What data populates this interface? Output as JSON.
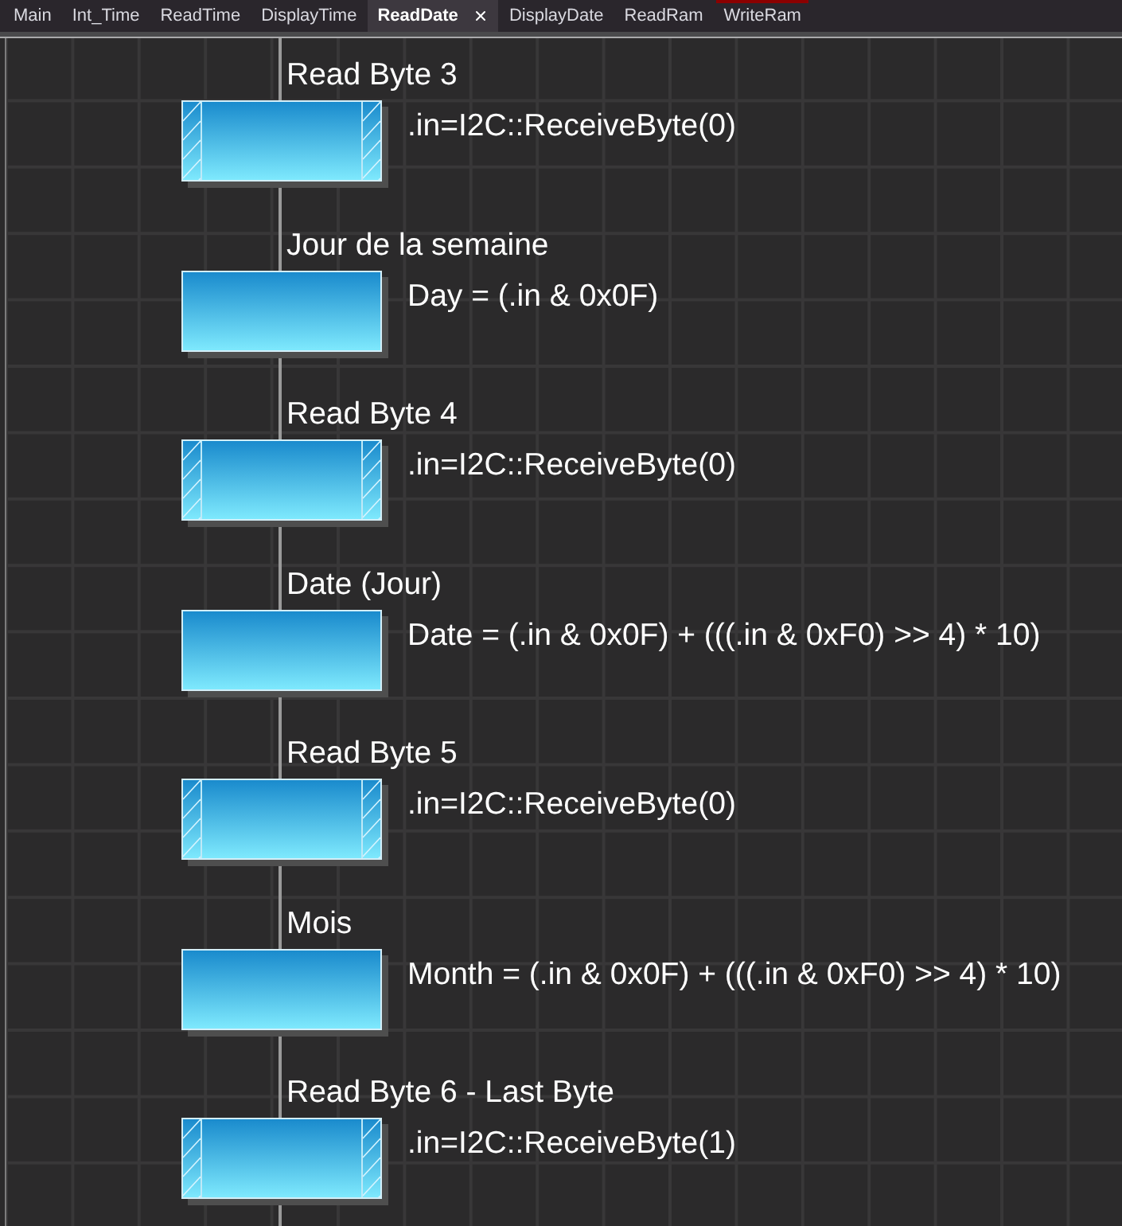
{
  "tabs": [
    {
      "label": "Main",
      "selected": false,
      "marked": false
    },
    {
      "label": "Int_Time",
      "selected": false,
      "marked": false
    },
    {
      "label": "ReadTime",
      "selected": false,
      "marked": false
    },
    {
      "label": "DisplayTime",
      "selected": false,
      "marked": false
    },
    {
      "label": "ReadDate",
      "selected": true,
      "marked": false
    },
    {
      "label": "DisplayDate",
      "selected": false,
      "marked": false
    },
    {
      "label": "ReadRam",
      "selected": false,
      "marked": false
    },
    {
      "label": "WriteRam",
      "selected": false,
      "marked": true
    }
  ],
  "flowchart": {
    "steps": [
      {
        "kind": "io",
        "label": "Read Byte 3",
        "code": ".in=I2C::ReceiveByte(0)"
      },
      {
        "kind": "process",
        "label": "Jour de la semaine",
        "code": "Day = (.in & 0x0F)"
      },
      {
        "kind": "io",
        "label": "Read Byte 4",
        "code": ".in=I2C::ReceiveByte(0)"
      },
      {
        "kind": "process",
        "label": "Date (Jour)",
        "code": "Date = (.in & 0x0F) + (((.in & 0xF0) >> 4) * 10)"
      },
      {
        "kind": "io",
        "label": "Read Byte 5",
        "code": ".in=I2C::ReceiveByte(0)"
      },
      {
        "kind": "process",
        "label": "Mois",
        "code": "Month = (.in & 0x0F) + (((.in & 0xF0) >> 4) * 10)"
      },
      {
        "kind": "io",
        "label": "Read Byte 6 - Last Byte",
        "code": ".in=I2C::ReceiveByte(1)"
      }
    ]
  }
}
